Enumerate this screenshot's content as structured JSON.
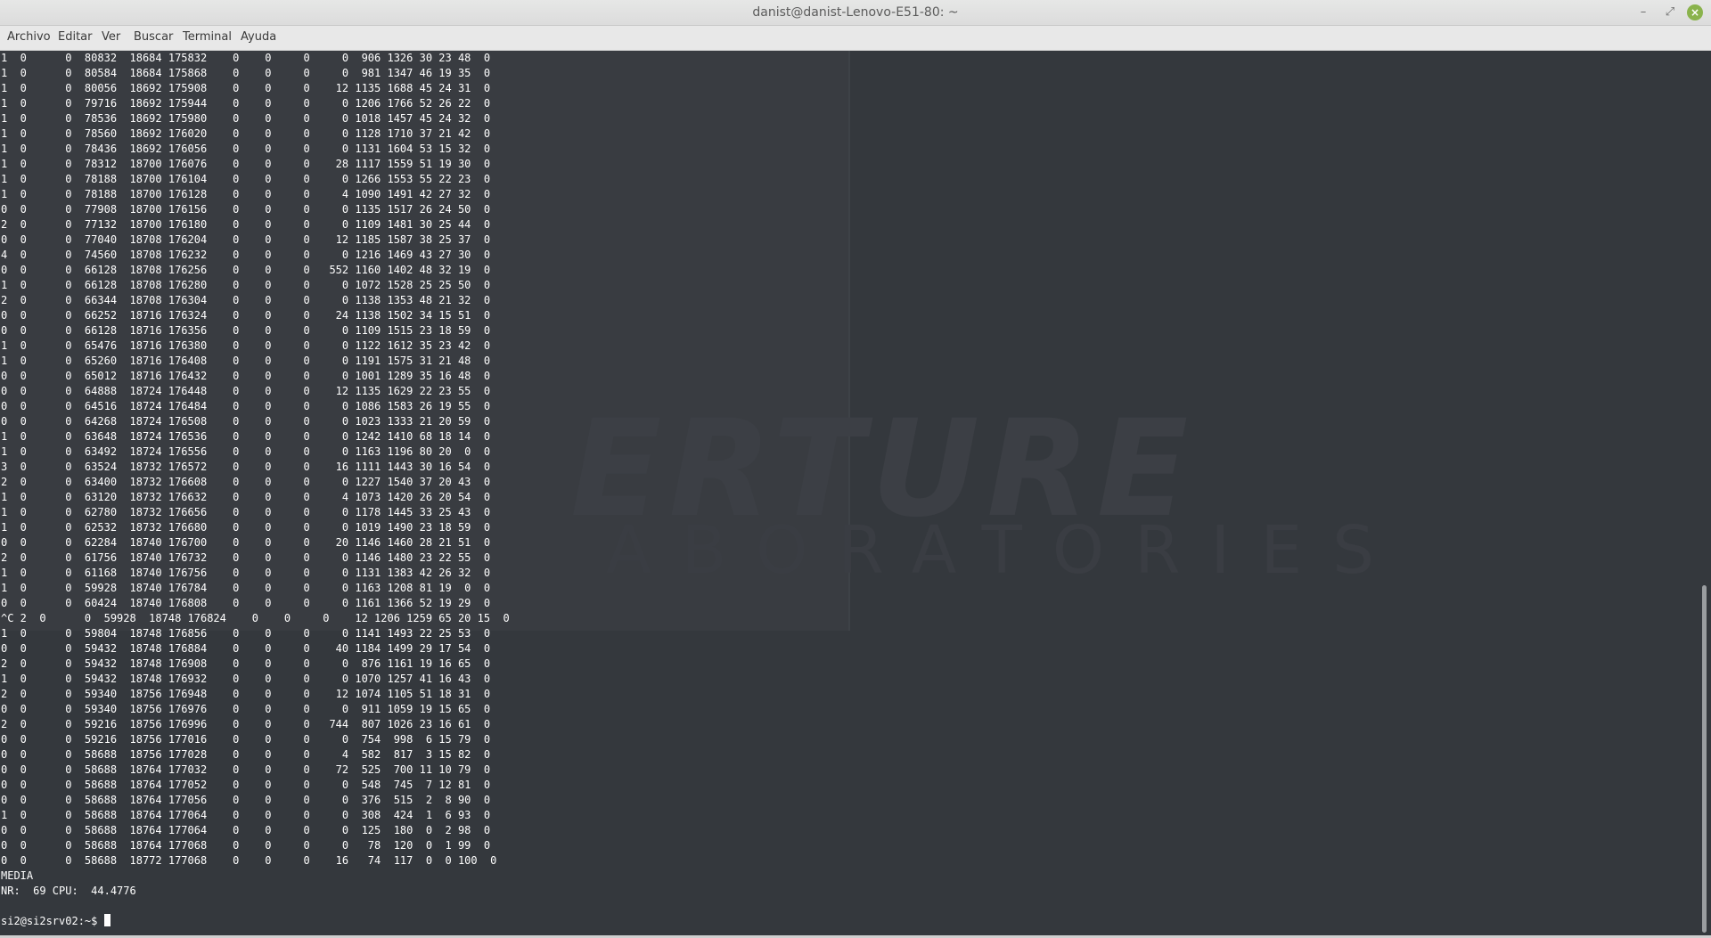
{
  "window": {
    "title": "danist@danist-Lenovo-E51-80: ~",
    "minimize_glyph": "–",
    "maximize_glyph": "⤢",
    "close_glyph": "×"
  },
  "wallpaper": {
    "logo_line1": "ERTURE",
    "logo_line2": "ABORATORIES"
  },
  "menu": {
    "items": [
      "Archivo",
      "Editar",
      "Ver",
      "Buscar",
      "Terminal",
      "Ayuda"
    ]
  },
  "terminal": {
    "lines": [
      "1  0      0  80832  18684 175832    0    0     0     0  906 1326 30 23 48  0",
      "1  0      0  80584  18684 175868    0    0     0     0  981 1347 46 19 35  0",
      "1  0      0  80056  18692 175908    0    0     0    12 1135 1688 45 24 31  0",
      "1  0      0  79716  18692 175944    0    0     0     0 1206 1766 52 26 22  0",
      "1  0      0  78536  18692 175980    0    0     0     0 1018 1457 45 24 32  0",
      "1  0      0  78560  18692 176020    0    0     0     0 1128 1710 37 21 42  0",
      "1  0      0  78436  18692 176056    0    0     0     0 1131 1604 53 15 32  0",
      "1  0      0  78312  18700 176076    0    0     0    28 1117 1559 51 19 30  0",
      "1  0      0  78188  18700 176104    0    0     0     0 1266 1553 55 22 23  0",
      "1  0      0  78188  18700 176128    0    0     0     4 1090 1491 42 27 32  0",
      "0  0      0  77908  18700 176156    0    0     0     0 1135 1517 26 24 50  0",
      "2  0      0  77132  18700 176180    0    0     0     0 1109 1481 30 25 44  0",
      "0  0      0  77040  18708 176204    0    0     0    12 1185 1587 38 25 37  0",
      "4  0      0  74560  18708 176232    0    0     0     0 1216 1469 43 27 30  0",
      "0  0      0  66128  18708 176256    0    0     0   552 1160 1402 48 32 19  0",
      "1  0      0  66128  18708 176280    0    0     0     0 1072 1528 25 25 50  0",
      "2  0      0  66344  18708 176304    0    0     0     0 1138 1353 48 21 32  0",
      "0  0      0  66252  18716 176324    0    0     0    24 1138 1502 34 15 51  0",
      "0  0      0  66128  18716 176356    0    0     0     0 1109 1515 23 18 59  0",
      "1  0      0  65476  18716 176380    0    0     0     0 1122 1612 35 23 42  0",
      "1  0      0  65260  18716 176408    0    0     0     0 1191 1575 31 21 48  0",
      "0  0      0  65012  18716 176432    0    0     0     0 1001 1289 35 16 48  0",
      "0  0      0  64888  18724 176448    0    0     0    12 1135 1629 22 23 55  0",
      "0  0      0  64516  18724 176484    0    0     0     0 1086 1583 26 19 55  0",
      "0  0      0  64268  18724 176508    0    0     0     0 1023 1333 21 20 59  0",
      "1  0      0  63648  18724 176536    0    0     0     0 1242 1410 68 18 14  0",
      "1  0      0  63492  18724 176556    0    0     0     0 1163 1196 80 20  0  0",
      "3  0      0  63524  18732 176572    0    0     0    16 1111 1443 30 16 54  0",
      "2  0      0  63400  18732 176608    0    0     0     0 1227 1540 37 20 43  0",
      "1  0      0  63120  18732 176632    0    0     0     4 1073 1420 26 20 54  0",
      "1  0      0  62780  18732 176656    0    0     0     0 1178 1445 33 25 43  0",
      "1  0      0  62532  18732 176680    0    0     0     0 1019 1490 23 18 59  0",
      "0  0      0  62284  18740 176700    0    0     0    20 1146 1460 28 21 51  0",
      "2  0      0  61756  18740 176732    0    0     0     0 1146 1480 23 22 55  0",
      "1  0      0  61168  18740 176756    0    0     0     0 1131 1383 42 26 32  0",
      "1  0      0  59928  18740 176784    0    0     0     0 1163 1208 81 19  0  0",
      "0  0      0  60424  18740 176808    0    0     0     0 1161 1366 52 19 29  0",
      "^C 2  0      0  59928  18748 176824    0    0     0    12 1206 1259 65 20 15  0",
      "1  0      0  59804  18748 176856    0    0     0     0 1141 1493 22 25 53  0",
      "0  0      0  59432  18748 176884    0    0     0    40 1184 1499 29 17 54  0",
      "2  0      0  59432  18748 176908    0    0     0     0  876 1161 19 16 65  0",
      "1  0      0  59432  18748 176932    0    0     0     0 1070 1257 41 16 43  0",
      "2  0      0  59340  18756 176948    0    0     0    12 1074 1105 51 18 31  0",
      "0  0      0  59340  18756 176976    0    0     0     0  911 1059 19 15 65  0",
      "2  0      0  59216  18756 176996    0    0     0   744  807 1026 23 16 61  0",
      "0  0      0  59216  18756 177016    0    0     0     0  754  998  6 15 79  0",
      "0  0      0  58688  18756 177028    0    0     0     4  582  817  3 15 82  0",
      "0  0      0  58688  18764 177032    0    0     0    72  525  700 11 10 79  0",
      "0  0      0  58688  18764 177052    0    0     0     0  548  745  7 12 81  0",
      "0  0      0  58688  18764 177056    0    0     0     0  376  515  2  8 90  0",
      "1  0      0  58688  18764 177064    0    0     0     0  308  424  1  6 93  0",
      "0  0      0  58688  18764 177064    0    0     0     0  125  180  0  2 98  0",
      "0  0      0  58688  18764 177068    0    0     0     0   78  120  0  1 99  0",
      "0  0      0  58688  18772 177068    0    0     0    16   74  117  0  0 100  0",
      "MEDIA",
      "NR:  69 CPU:  44.4776",
      ""
    ],
    "prompt": "si2@si2srv02:~$ "
  }
}
